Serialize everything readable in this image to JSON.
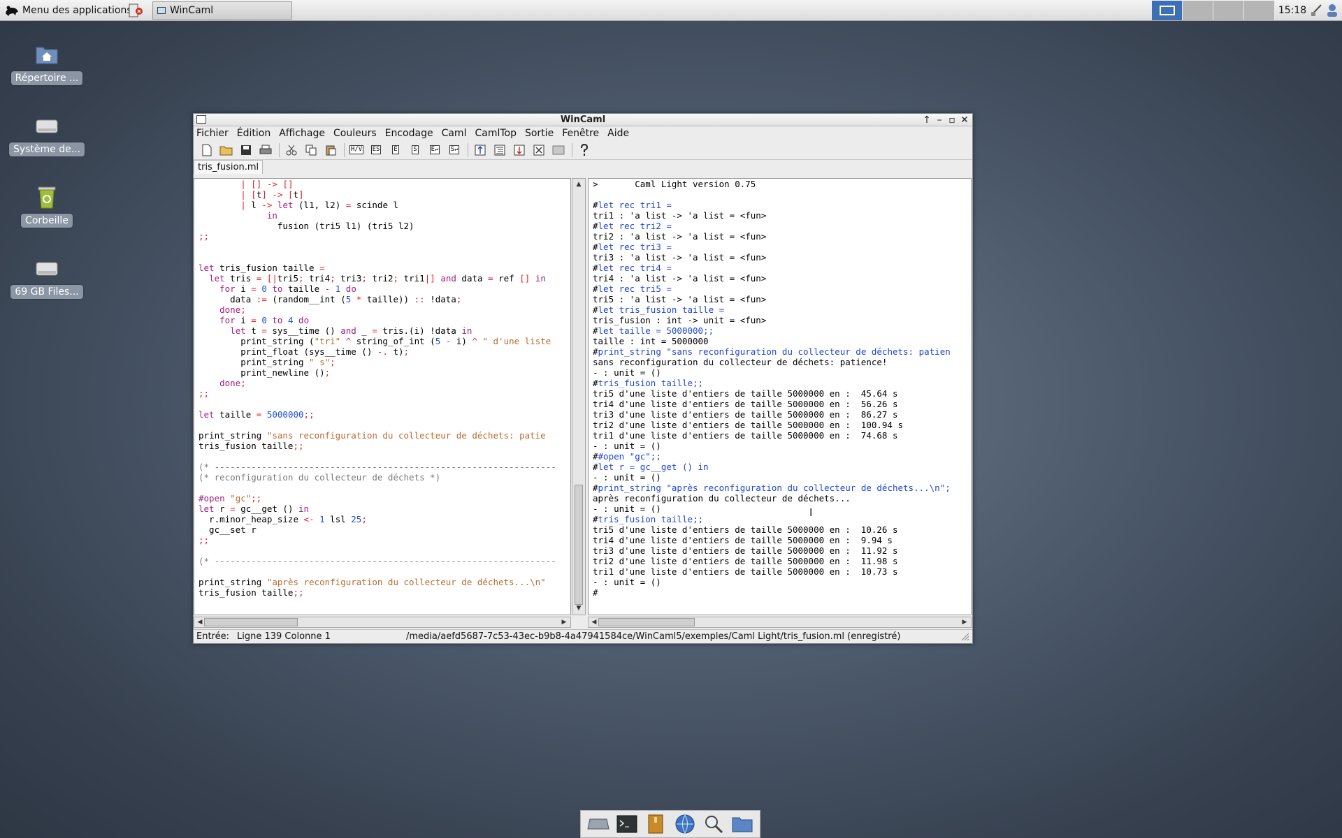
{
  "top_panel": {
    "app_menu_label": "Menu des applications",
    "taskbar_window_title": "WinCaml",
    "clock": "15:18"
  },
  "desktop_icons": [
    {
      "label": "Répertoire ...",
      "icon": "home-folder-icon"
    },
    {
      "label": "Système de...",
      "icon": "drive-icon"
    },
    {
      "label": "Corbeille",
      "icon": "trash-icon"
    },
    {
      "label": "69 GB Files...",
      "icon": "drive-icon"
    }
  ],
  "window": {
    "title": "WinCaml",
    "menu": [
      "Fichier",
      "Édition",
      "Affichage",
      "Couleurs",
      "Encodage",
      "Caml",
      "CamlTop",
      "Sortie",
      "Fenêtre",
      "Aide"
    ],
    "toolbar_box_labels": [
      "H/V",
      "ES",
      "E",
      "S",
      "E↵",
      "S↵"
    ],
    "tab": "tris_fusion.ml"
  },
  "editor_lines": [
    "        | [] -> []",
    "        | [t] -> [t]",
    "        | l -> let (l1, l2) = scinde l",
    "             in",
    "               fusion (tri5 l1) (tri5 l2)",
    ";;",
    "",
    "",
    "let tris_fusion taille =",
    "  let tris = [|tri5; tri4; tri3; tri2; tri1|] and data = ref [] in",
    "    for i = 0 to taille - 1 do",
    "      data := (random__int (5 * taille)) :: !data;",
    "    done;",
    "    for i = 0 to 4 do",
    "      let t = sys__time () and _ = tris.(i) !data in",
    "        print_string (\"tri\" ^ string_of_int (5 - i) ^ \" d'une liste",
    "        print_float (sys__time () -. t);",
    "        print_string \" s\";",
    "        print_newline ();",
    "    done;",
    ";;",
    "",
    "let taille = 5000000;;",
    "",
    "print_string \"sans reconfiguration du collecteur de déchets: patie",
    "tris_fusion taille;;",
    "",
    "(* -----------------------------------------------------------------",
    "(* reconfiguration du collecteur de déchets *)",
    "",
    "#open \"gc\";;",
    "let r = gc__get () in",
    "  r.minor_heap_size <- 1 lsl 25;",
    "  gc__set r",
    ";;",
    "",
    "(* -----------------------------------------------------------------",
    "",
    "print_string \"après reconfiguration du collecteur de déchets...\\n\"",
    "tris_fusion taille;;",
    ""
  ],
  "toplevel_lines": [
    ">       Caml Light version 0.75",
    "",
    "#let rec tri1 =",
    "tri1 : 'a list -> 'a list = <fun>",
    "#let rec tri2 =",
    "tri2 : 'a list -> 'a list = <fun>",
    "#let rec tri3 =",
    "tri3 : 'a list -> 'a list = <fun>",
    "#let rec tri4 =",
    "tri4 : 'a list -> 'a list = <fun>",
    "#let rec tri5 =",
    "tri5 : 'a list -> 'a list = <fun>",
    "#let tris_fusion taille =",
    "tris_fusion : int -> unit = <fun>",
    "#let taille = 5000000;;",
    "taille : int = 5000000",
    "#print_string \"sans reconfiguration du collecteur de déchets: patien",
    "sans reconfiguration du collecteur de déchets: patience!",
    "- : unit = ()",
    "#tris_fusion taille;;",
    "tri5 d'une liste d'entiers de taille 5000000 en :  45.64 s",
    "tri4 d'une liste d'entiers de taille 5000000 en :  56.26 s",
    "tri3 d'une liste d'entiers de taille 5000000 en :  86.27 s",
    "tri2 d'une liste d'entiers de taille 5000000 en :  100.94 s",
    "tri1 d'une liste d'entiers de taille 5000000 en :  74.68 s",
    "- : unit = ()",
    "##open \"gc\";;",
    "#let r = gc__get () in",
    "- : unit = ()",
    "#print_string \"après reconfiguration du collecteur de déchets...\\n\";",
    "après reconfiguration du collecteur de déchets...",
    "- : unit = ()",
    "#tris_fusion taille;;",
    "tri5 d'une liste d'entiers de taille 5000000 en :  10.26 s",
    "tri4 d'une liste d'entiers de taille 5000000 en :  9.94 s",
    "tri3 d'une liste d'entiers de taille 5000000 en :  11.92 s",
    "tri2 d'une liste d'entiers de taille 5000000 en :  11.98 s",
    "tri1 d'une liste d'entiers de taille 5000000 en :  10.73 s",
    "- : unit = ()",
    "#"
  ],
  "statusbar": {
    "mode": "Entrée:",
    "position": "Ligne 139 Colonne 1",
    "path": "/media/aefd5687-7c53-43ec-b9b8-4a47941584ce/WinCaml5/exemples/Caml Light/tris_fusion.ml (enregistré)"
  },
  "dock_items": [
    "drive-icon",
    "terminal-icon",
    "archive-icon",
    "web-browser-icon",
    "search-icon",
    "folder-icon"
  ],
  "colors": {
    "keyword": "#a02080",
    "operator": "#e0202c",
    "number": "#1e50d0",
    "string": "#b86a30",
    "comment": "#7a7a7a",
    "toplevel_input": "#1e46d6",
    "active_workspace": "#3d6fb5"
  }
}
